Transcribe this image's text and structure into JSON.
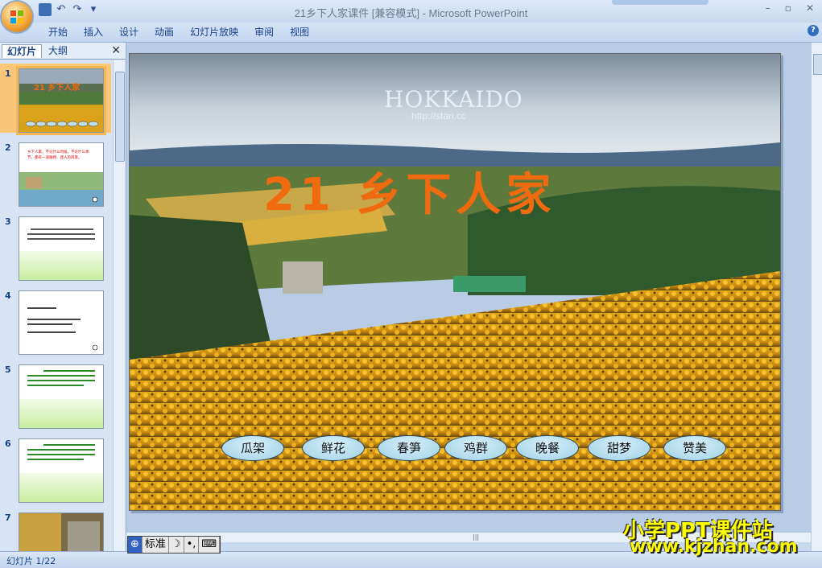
{
  "window": {
    "title": "21乡下人家课件 [兼容模式] - Microsoft PowerPoint",
    "qat_undo": "↶",
    "qat_redo": "↷",
    "qat_more": "▾",
    "minimize": "–",
    "restore": "▫",
    "close": "✕"
  },
  "ribbon": {
    "tabs": [
      "开始",
      "插入",
      "设计",
      "动画",
      "幻灯片放映",
      "审阅",
      "视图"
    ],
    "help": "?"
  },
  "left_pane": {
    "tab_slides": "幻灯片",
    "tab_outline": "大纲",
    "close": "✕",
    "slides": [
      {
        "num": "1",
        "title": "21 乡下人家"
      },
      {
        "num": "2",
        "text": "乡下人家，不论什么时候，不论什么季节，都有一道独特、迷人的风景。"
      },
      {
        "num": "3"
      },
      {
        "num": "4"
      },
      {
        "num": "5"
      },
      {
        "num": "6"
      },
      {
        "num": "7"
      }
    ]
  },
  "slide": {
    "background_label": "HOKKAIDO",
    "background_url": "http://stan.cc",
    "title": "21 乡下人家",
    "title_color": "#f06a10",
    "keywords": [
      "瓜架",
      "鲜花",
      "春笋",
      "鸡群",
      "晚餐",
      "甜梦",
      "赞美"
    ]
  },
  "ime": {
    "mode": "标准",
    "moon": "☽",
    "punct": "•,",
    "keyboard": "⌨"
  },
  "status": {
    "slide_counter": "幻灯片 1/22"
  },
  "watermark": {
    "line1": "小学PPT课件站",
    "line2": "www.kjzhan.com"
  }
}
